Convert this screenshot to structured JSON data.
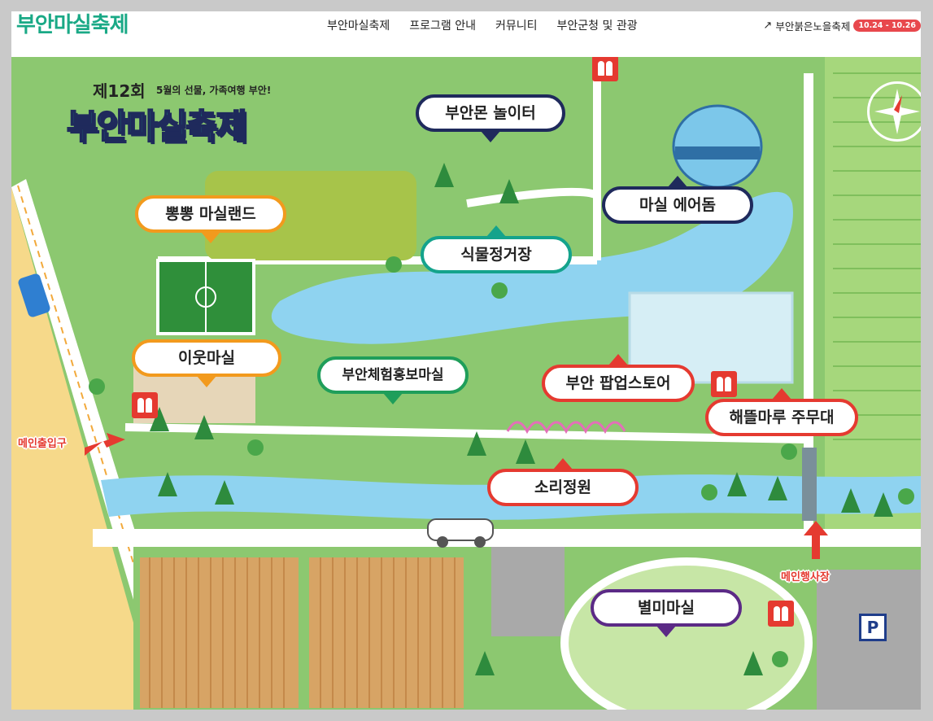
{
  "header": {
    "logo_text": "부안마실축제",
    "nav": [
      "부안마실축제",
      "프로그램 안내",
      "커뮤니티",
      "부안군청 및 관광"
    ],
    "external_link_label": "부안붉은노을축제",
    "external_badge": "10.24 - 10.26"
  },
  "map": {
    "title_edition": "제12회",
    "title_tagline": "5월의 선물, 가족여행 부안!",
    "title_main": "부안마실축제",
    "callouts": {
      "buanmon": "부안몬 놀이터",
      "air_dome": "마실 에어돔",
      "ppongppong": "뽕뽕 마실랜드",
      "plant": "식물정거장",
      "neighbor": "이웃마실",
      "experience": "부안체험홍보마실",
      "popup": "부안 팝업스토어",
      "stage": "해뜰마루 주무대",
      "sound_garden": "소리정원",
      "byeolmi": "별미마실"
    },
    "labels": {
      "main_entrance": "메인출입구",
      "main_venue": "메인행사장"
    },
    "icons": {
      "restroom": "restroom-icon",
      "parking": "P",
      "compass": "compass-icon"
    },
    "colors": {
      "brand_green": "#1aa986",
      "grass": "#7fc06a",
      "water": "#8fd3f0",
      "path": "#ffffff",
      "callout_red": "#e53a30",
      "callout_navy": "#1f2a5c"
    }
  }
}
